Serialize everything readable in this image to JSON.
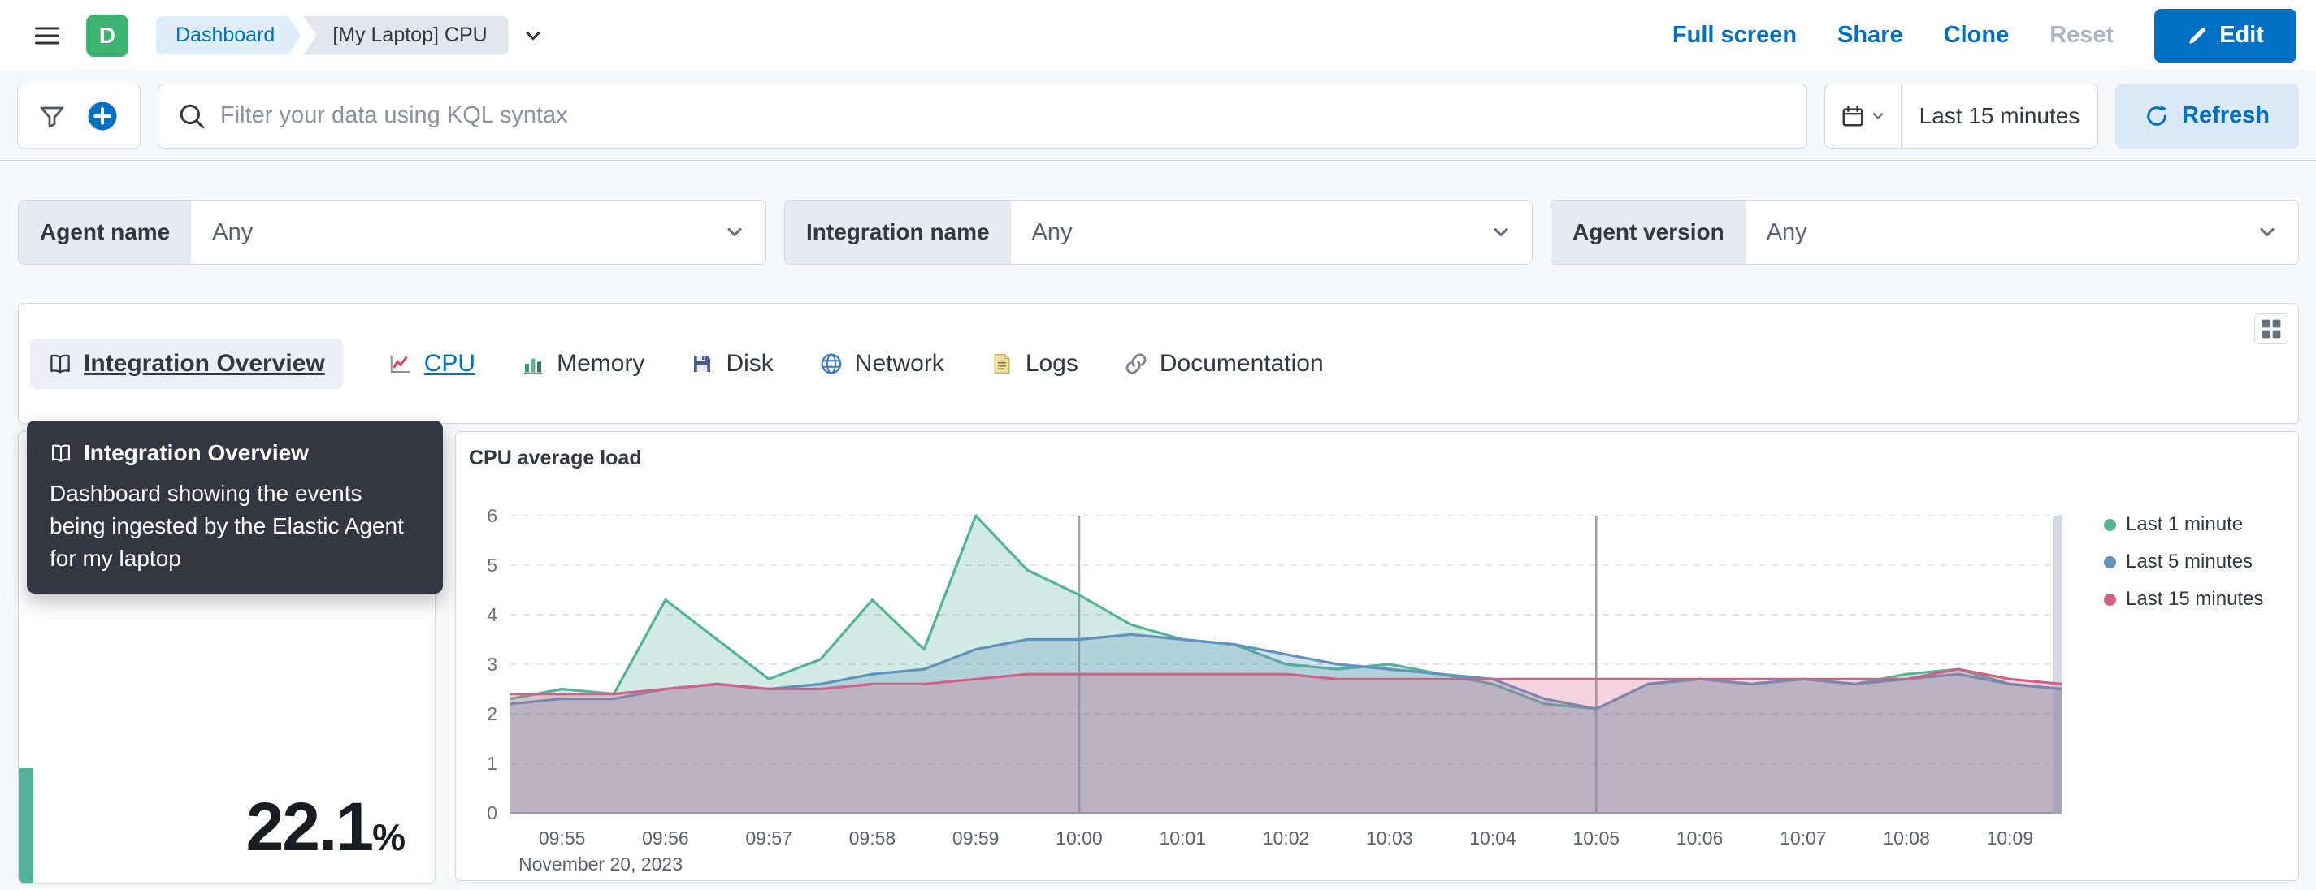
{
  "header": {
    "space_initial": "D",
    "breadcrumbs": {
      "root": "Dashboard",
      "current": "[My Laptop] CPU"
    },
    "actions": {
      "full_screen": "Full screen",
      "share": "Share",
      "clone": "Clone",
      "reset": "Reset",
      "edit": "Edit"
    }
  },
  "filter_bar": {
    "search_placeholder": "Filter your data using KQL syntax",
    "time_range": "Last 15 minutes",
    "refresh_label": "Refresh"
  },
  "controls": [
    {
      "label": "Agent name",
      "value": "Any"
    },
    {
      "label": "Integration name",
      "value": "Any"
    },
    {
      "label": "Agent version",
      "value": "Any"
    }
  ],
  "links_panel": {
    "tabs": [
      {
        "label": "Integration Overview"
      },
      {
        "label": "CPU"
      },
      {
        "label": "Memory"
      },
      {
        "label": "Disk"
      },
      {
        "label": "Network"
      },
      {
        "label": "Logs"
      },
      {
        "label": "Documentation"
      }
    ]
  },
  "tooltip": {
    "title": "Integration Overview",
    "body": "Dashboard showing the events being ingested by the Elastic Agent for my laptop"
  },
  "metric_panel": {
    "value": "22.1",
    "unit": "%"
  },
  "colors": {
    "primary": "#0071C2",
    "metric_accent": "#54B399"
  },
  "chart_data": {
    "type": "area",
    "title": "CPU average load",
    "x_date_label": "November 20, 2023",
    "x": [
      "09:54:30",
      "09:55:00",
      "09:55:30",
      "09:56:00",
      "09:56:30",
      "09:57:00",
      "09:57:30",
      "09:58:00",
      "09:58:30",
      "09:59:00",
      "09:59:30",
      "10:00:00",
      "10:00:30",
      "10:01:00",
      "10:01:30",
      "10:02:00",
      "10:02:30",
      "10:03:00",
      "10:03:30",
      "10:04:00",
      "10:04:30",
      "10:05:00",
      "10:05:30",
      "10:06:00",
      "10:06:30",
      "10:07:00",
      "10:07:30",
      "10:08:00",
      "10:08:30",
      "10:09:00",
      "10:09:30"
    ],
    "x_ticks": [
      "09:55",
      "09:56",
      "09:57",
      "09:58",
      "09:59",
      "10:00",
      "10:01",
      "10:02",
      "10:03",
      "10:04",
      "10:05",
      "10:06",
      "10:07",
      "10:08",
      "10:09"
    ],
    "emphasized_ticks": [
      "10:00",
      "10:05"
    ],
    "ylim": [
      0,
      6
    ],
    "y_ticks": [
      0,
      1,
      2,
      3,
      4,
      5,
      6
    ],
    "grid": "horizontal-dashed",
    "legend_position": "right",
    "series": [
      {
        "name": "Last 1 minute",
        "color": "#54B399",
        "values": [
          2.3,
          2.5,
          2.4,
          4.3,
          3.5,
          2.7,
          3.1,
          4.3,
          3.3,
          6.0,
          4.9,
          4.4,
          3.8,
          3.5,
          3.4,
          3.0,
          2.9,
          3.0,
          2.8,
          2.6,
          2.2,
          2.1,
          2.6,
          2.7,
          2.6,
          2.7,
          2.6,
          2.8,
          2.9,
          2.6,
          2.5
        ]
      },
      {
        "name": "Last 5 minutes",
        "color": "#6092C0",
        "values": [
          2.2,
          2.3,
          2.3,
          2.5,
          2.6,
          2.5,
          2.6,
          2.8,
          2.9,
          3.3,
          3.5,
          3.5,
          3.6,
          3.5,
          3.4,
          3.2,
          3.0,
          2.9,
          2.8,
          2.7,
          2.3,
          2.1,
          2.6,
          2.7,
          2.6,
          2.7,
          2.6,
          2.7,
          2.8,
          2.6,
          2.5
        ]
      },
      {
        "name": "Last 15 minutes",
        "color": "#D36086",
        "values": [
          2.4,
          2.4,
          2.4,
          2.5,
          2.6,
          2.5,
          2.5,
          2.6,
          2.6,
          2.7,
          2.8,
          2.8,
          2.8,
          2.8,
          2.8,
          2.8,
          2.7,
          2.7,
          2.7,
          2.7,
          2.7,
          2.7,
          2.7,
          2.7,
          2.7,
          2.7,
          2.7,
          2.7,
          2.9,
          2.7,
          2.6
        ]
      }
    ]
  }
}
